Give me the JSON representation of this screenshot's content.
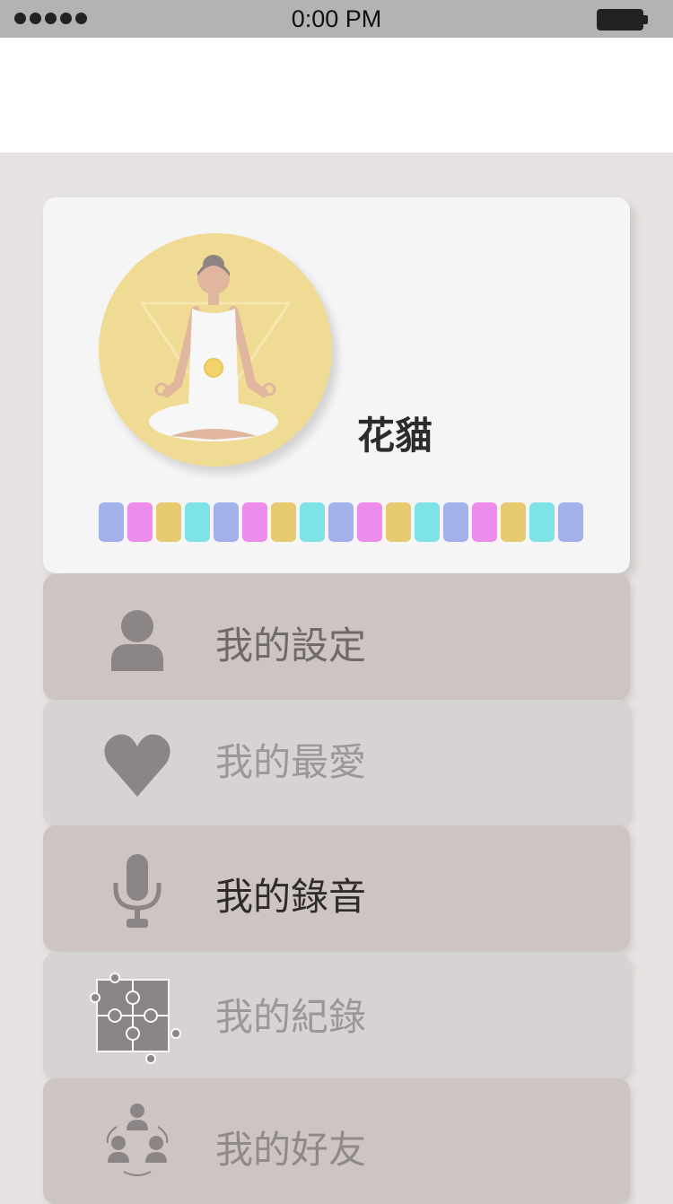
{
  "status_bar": {
    "time": "0:00 PM",
    "signal_dots": 5
  },
  "profile": {
    "name": "花貓",
    "avatar_icon": "meditation-avatar",
    "color_chips": [
      "#a3b1ea",
      "#ee8ceb",
      "#e7ca6f",
      "#7de3e6",
      "#a3b1ea",
      "#ee8ceb",
      "#e7ca6f",
      "#7de3e6",
      "#a3b1ea",
      "#ee8ceb",
      "#e7ca6f",
      "#7de3e6",
      "#a3b1ea",
      "#ee8ceb",
      "#e7ca6f",
      "#7de3e6",
      "#a3b1ea"
    ]
  },
  "menu": [
    {
      "label": "我的設定",
      "icon": "person-icon"
    },
    {
      "label": "我的最愛",
      "icon": "heart-icon"
    },
    {
      "label": "我的錄音",
      "icon": "microphone-icon"
    },
    {
      "label": "我的紀錄",
      "icon": "puzzle-icon"
    },
    {
      "label": "我的好友",
      "icon": "friends-icon"
    }
  ],
  "colors": {
    "background": "#e6e2e1",
    "card": "#f5f5f5",
    "menu_dark": "#cdc4c3",
    "menu_light": "#d8d3d3",
    "icon_gray": "#8b8585",
    "avatar_bg": "#efdb93"
  }
}
